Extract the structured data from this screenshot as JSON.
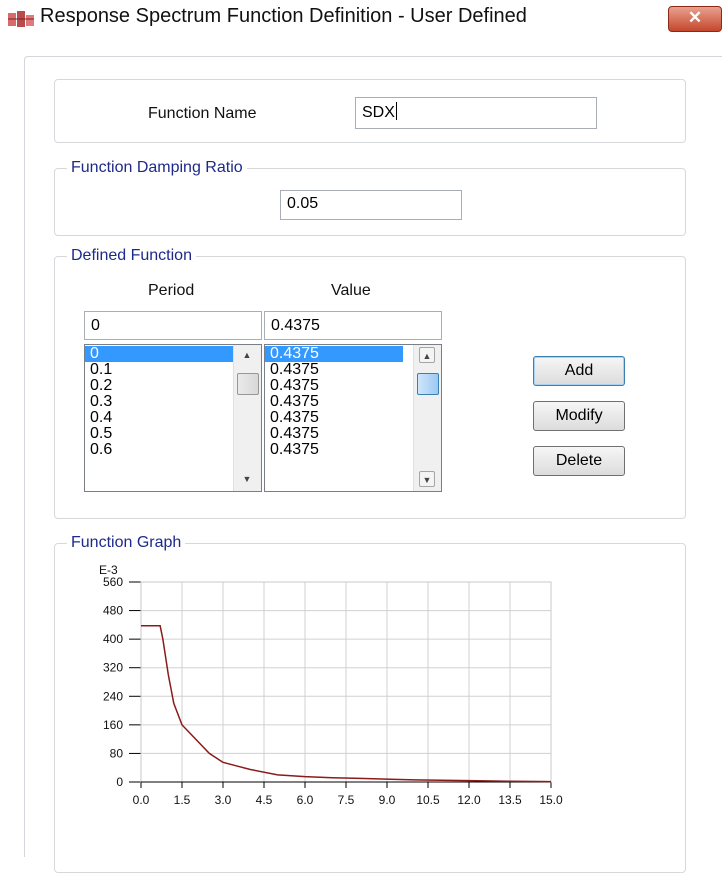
{
  "window": {
    "title": "Response Spectrum Function Definition - User Defined",
    "close_glyph": "✕"
  },
  "function_name": {
    "label": "Function Name",
    "value": "SDX"
  },
  "damping": {
    "group_title": "Function Damping Ratio",
    "value": "0.05"
  },
  "defined_function": {
    "group_title": "Defined Function",
    "period_header": "Period",
    "value_header": "Value",
    "period_input": "0",
    "value_input": "0.4375",
    "periods": [
      "0",
      "0.1",
      "0.2",
      "0.3",
      "0.4",
      "0.5",
      "0.6"
    ],
    "values": [
      "0.4375",
      "0.4375",
      "0.4375",
      "0.4375",
      "0.4375",
      "0.4375",
      "0.4375"
    ],
    "selected_index": 0,
    "buttons": {
      "add": "Add",
      "modify": "Modify",
      "delete": "Delete"
    }
  },
  "graph": {
    "group_title": "Function Graph"
  },
  "chart_data": {
    "type": "line",
    "title": "",
    "xlabel": "",
    "ylabel": "",
    "y_multiplier_label": "E-3",
    "xlim": [
      0,
      15
    ],
    "ylim": [
      0,
      560
    ],
    "x_ticks": [
      "0.0",
      "1.5",
      "3.0",
      "4.5",
      "6.0",
      "7.5",
      "9.0",
      "10.5",
      "12.0",
      "13.5",
      "15.0"
    ],
    "y_ticks": [
      "0",
      "80",
      "160",
      "240",
      "320",
      "400",
      "480",
      "560"
    ],
    "grid": true,
    "series": [
      {
        "color": "#8b1a1a",
        "x": [
          0,
          0.7,
          0.8,
          1.0,
          1.2,
          1.5,
          2.0,
          2.5,
          3.0,
          3.5,
          4.0,
          5.0,
          6.0,
          7.0,
          8.0,
          10.0,
          12.0,
          13.5,
          15.0
        ],
        "y": [
          437.5,
          437.5,
          400,
          300,
          220,
          160,
          120,
          80,
          55,
          45,
          35,
          20,
          15,
          12,
          10,
          6,
          4,
          2,
          1
        ]
      }
    ]
  }
}
